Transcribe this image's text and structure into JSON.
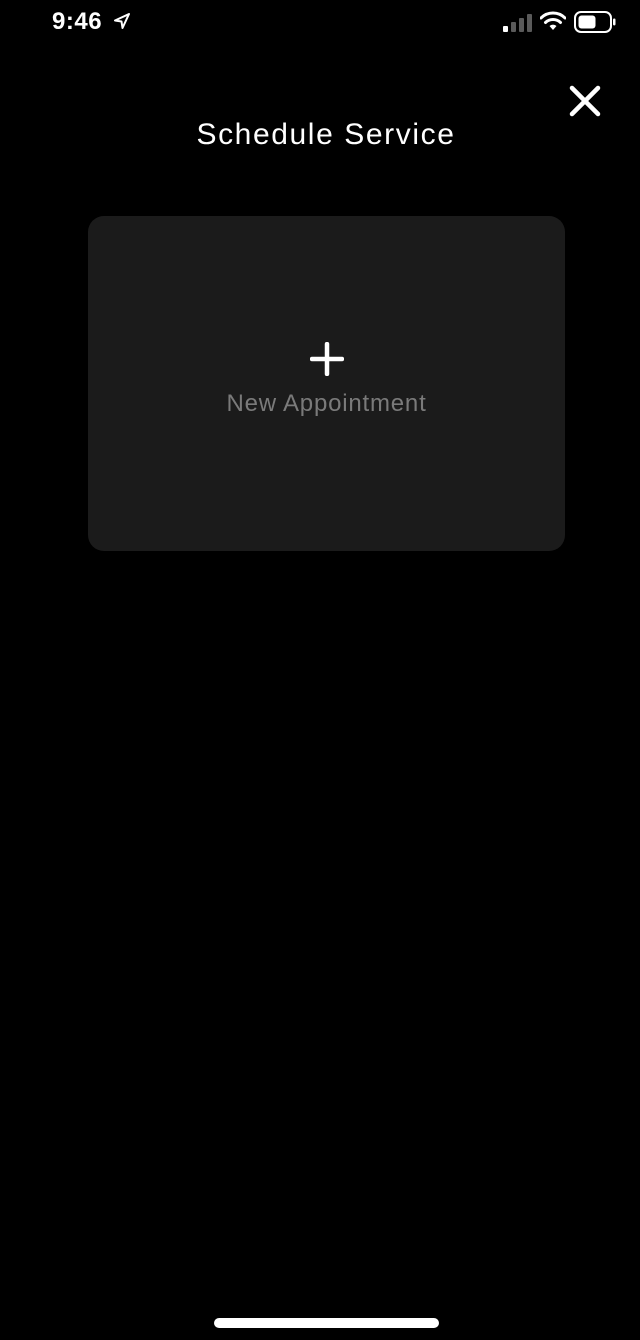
{
  "status_bar": {
    "time": "9:46",
    "icons": [
      "location-arrow-icon",
      "cellular-signal-icon",
      "wifi-icon",
      "battery-icon"
    ]
  },
  "header": {
    "title": "Schedule Service",
    "close_icon": "close-icon"
  },
  "card": {
    "label": "New Appointment",
    "icon": "plus-icon"
  },
  "colors": {
    "background": "#000000",
    "card_background": "#1b1b1b",
    "card_label": "#7a7a7a",
    "text_primary": "#ffffff"
  }
}
